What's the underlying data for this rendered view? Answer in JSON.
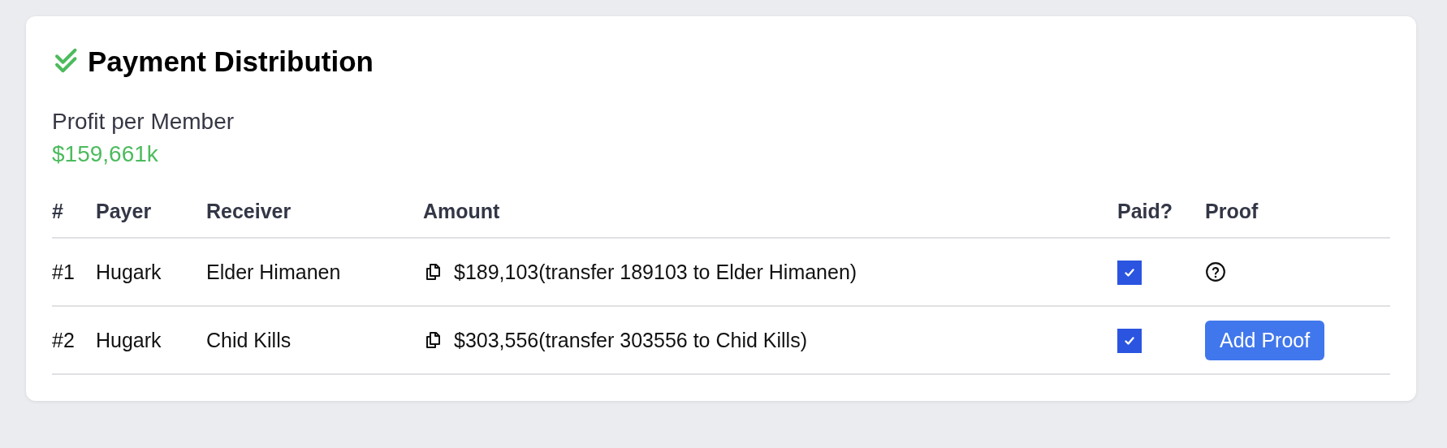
{
  "card": {
    "title": "Payment Distribution",
    "profit_label": "Profit per Member",
    "profit_value": "$159,661k"
  },
  "table": {
    "columns": [
      "#",
      "Payer",
      "Receiver",
      "Amount",
      "Paid?",
      "Proof"
    ],
    "rows": [
      {
        "index": "#1",
        "payer": "Hugark",
        "receiver": "Elder Himanen",
        "amount": "$189,103(transfer 189103 to Elder Himanen)",
        "paid": true,
        "proof": {
          "kind": "help"
        }
      },
      {
        "index": "#2",
        "payer": "Hugark",
        "receiver": "Chid Kills",
        "amount": "$303,556(transfer 303556 to Chid Kills)",
        "paid": true,
        "proof": {
          "kind": "button",
          "label": "Add Proof"
        }
      }
    ]
  }
}
